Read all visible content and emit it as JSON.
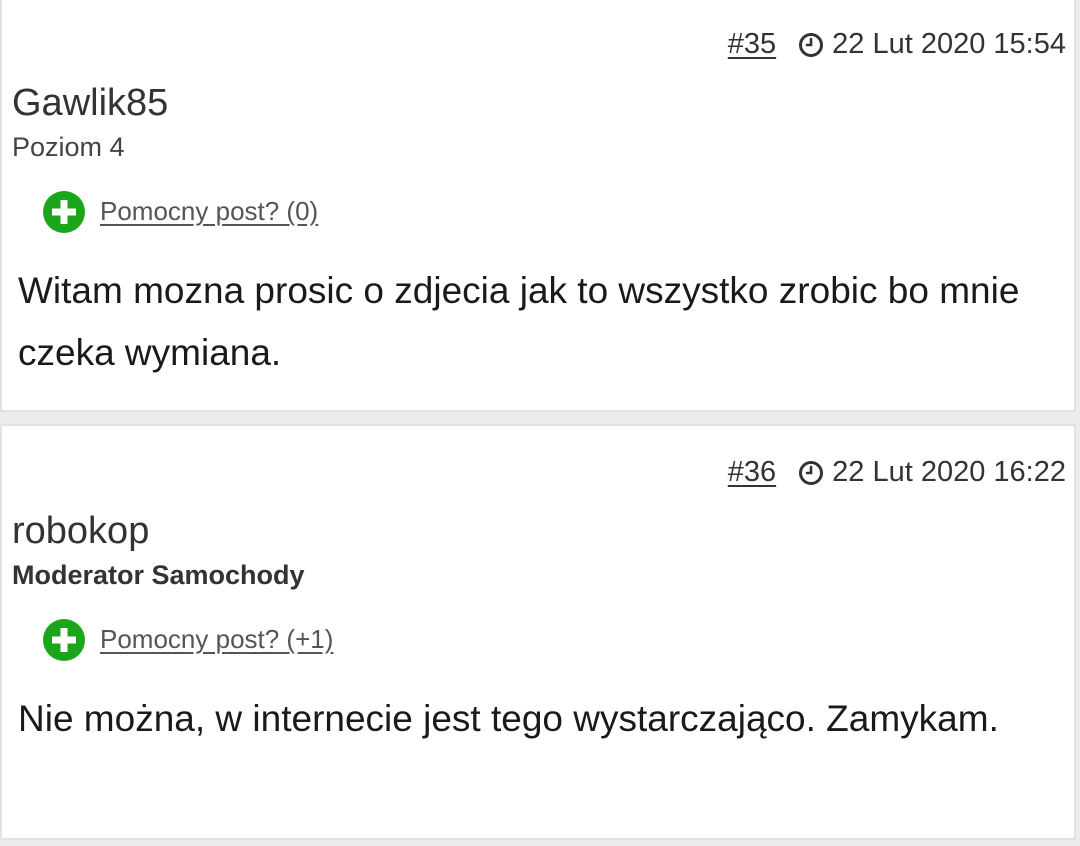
{
  "posts": [
    {
      "number": "#35",
      "date": "22 Lut 2020 15:54",
      "author": "Gawlik85",
      "rank": "Poziom 4",
      "helpful": "Pomocny post? (0)",
      "body": "Witam mozna prosic o zdjecia jak to wszystko zrobic bo mnie czeka wymiana."
    },
    {
      "number": "#36",
      "date": "22 Lut 2020 16:22",
      "author": "robokop",
      "rank": "Moderator Samochody",
      "helpful": "Pomocny post? (+1)",
      "body": "Nie można, w internecie jest tego wystarczająco. Zamykam."
    }
  ],
  "icons": {
    "clock": "clock-icon",
    "plus": "plus-circle-icon"
  },
  "colors": {
    "helpful_green": "#1aa51a",
    "card_border": "#e2e2e2"
  }
}
